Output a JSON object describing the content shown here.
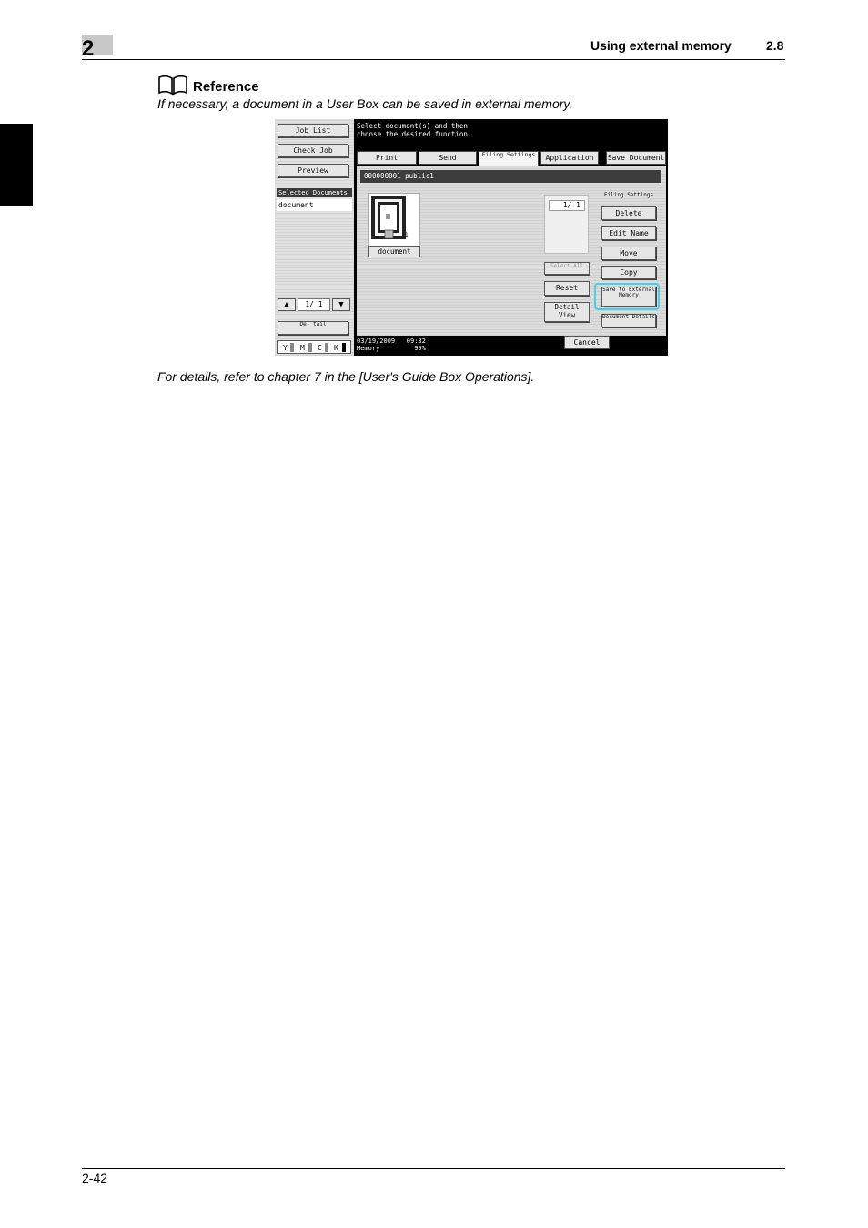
{
  "header": {
    "chapter": "2",
    "title": "Using external memory",
    "section": "2.8"
  },
  "reference": {
    "icon": "open-book-icon",
    "heading": "Reference",
    "text": "If necessary, a document in a User Box can be saved in external memory."
  },
  "screen": {
    "left_buttons": [
      "Job List",
      "Check Job",
      "Preview"
    ],
    "selected_header": "Selected Documents",
    "selected_item": "document",
    "left_pager": "1/ 1",
    "detail_button": "De- tail",
    "cmyk": [
      "Y",
      "M",
      "C",
      "K"
    ],
    "instruction": "Select document(s) and then\nchoose the desired function.",
    "tabs": [
      "Print",
      "Send",
      "Filing Settings",
      "Application",
      "Save Document"
    ],
    "box_header": "000000001  public1",
    "document_label": "document",
    "page_indicator": "1/  1",
    "middle_buttons": {
      "select_all": "Select All",
      "reset": "Reset",
      "detail_view": "Detail View"
    },
    "filing_label": "Filing Settings",
    "filing_buttons": [
      "Delete",
      "Edit Name",
      "Move",
      "Copy"
    ],
    "save_external": "Save to External Memory",
    "document_details": "Document Details",
    "status": "03/19/2009   09:32\nMemory         99%",
    "cancel": "Cancel"
  },
  "detail_text": "For details, refer to chapter 7 in the [User's Guide Box Operations].",
  "footer": {
    "page": "2-42"
  }
}
